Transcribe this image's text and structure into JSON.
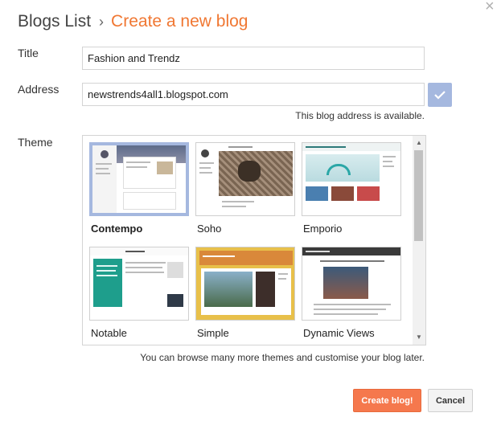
{
  "dialog": {
    "close_label": "×",
    "breadcrumb_root": "Blogs List",
    "breadcrumb_separator": "›",
    "breadcrumb_current": "Create a new blog"
  },
  "form": {
    "title_label": "Title",
    "title_value": "Fashion and Trendz",
    "address_label": "Address",
    "address_value": "newstrends4all1.blogspot.com",
    "address_status": "This blog address is available.",
    "theme_label": "Theme"
  },
  "themes": [
    {
      "name": "Contempo",
      "selected": true
    },
    {
      "name": "Soho",
      "selected": false
    },
    {
      "name": "Emporio",
      "selected": false
    },
    {
      "name": "Notable",
      "selected": false
    },
    {
      "name": "Simple",
      "selected": false
    },
    {
      "name": "Dynamic Views",
      "selected": false
    }
  ],
  "browse_note": "You can browse many more themes and customise your blog later.",
  "buttons": {
    "create": "Create blog!",
    "cancel": "Cancel"
  },
  "colors": {
    "accent": "#f07732",
    "create_button": "#f5784d",
    "selection": "#a5b8df"
  }
}
